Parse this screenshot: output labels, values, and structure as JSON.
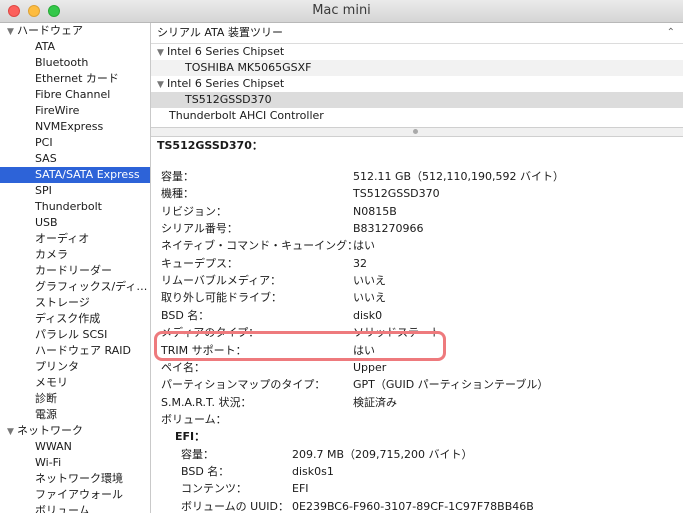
{
  "window": {
    "title": "Mac mini"
  },
  "sidebar": {
    "hardware_label": "ハードウェア",
    "hardware_items": [
      "ATA",
      "Bluetooth",
      "Ethernet カード",
      "Fibre Channel",
      "FireWire",
      "NVMExpress",
      "PCI",
      "SAS",
      "SATA/SATA Express",
      "SPI",
      "Thunderbolt",
      "USB",
      "オーディオ",
      "カメラ",
      "カードリーダー",
      "グラフィックス/ディ…",
      "ストレージ",
      "ディスク作成",
      "パラレル SCSI",
      "ハードウェア RAID",
      "プリンタ",
      "メモリ",
      "診断",
      "電源"
    ],
    "selected_item": "SATA/SATA Express",
    "network_label": "ネットワーク",
    "network_items": [
      "WWAN",
      "Wi-Fi",
      "ネットワーク環境",
      "ファイアウォール",
      "ボリューム"
    ]
  },
  "tree": {
    "header": "シリアル ATA 装置ツリー",
    "rows": [
      {
        "text": "Intel 6 Series Chipset",
        "level": 0
      },
      {
        "text": "TOSHIBA MK5065GSXF",
        "level": 1
      },
      {
        "text": "Intel 6 Series Chipset",
        "level": 0
      },
      {
        "text": "TS512GSSD370",
        "level": 1,
        "selected": true
      },
      {
        "text": "Thunderbolt AHCI Controller",
        "level": 0
      }
    ]
  },
  "detail": {
    "title": "TS512GSSD370：",
    "rows": [
      {
        "k": "容量：",
        "v": "512.11 GB（512,110,190,592 バイト）"
      },
      {
        "k": "機種：",
        "v": "TS512GSSD370"
      },
      {
        "k": "リビジョン：",
        "v": "N0815B"
      },
      {
        "k": "シリアル番号：",
        "v": "B831270966"
      },
      {
        "k": "ネイティブ・コマンド・キューイング：",
        "v": "はい"
      },
      {
        "k": "キューデプス：",
        "v": "32"
      },
      {
        "k": "リムーバブルメディア：",
        "v": "いいえ"
      },
      {
        "k": "取り外し可能ドライブ：",
        "v": "いいえ"
      },
      {
        "k": "BSD 名：",
        "v": "disk0"
      },
      {
        "k": "メディアのタイプ：",
        "v": "ソリッドステート"
      },
      {
        "k": "TRIM サポート：",
        "v": "はい"
      },
      {
        "k": "ペイ名：",
        "v": "Upper"
      },
      {
        "k": "パーティションマップのタイプ：",
        "v": "GPT（GUID パーティションテーブル）"
      },
      {
        "k": "S.M.A.R.T. 状況：",
        "v": "検証済み"
      },
      {
        "k": "ボリューム：",
        "v": ""
      }
    ],
    "volume_name": "EFI：",
    "volume_rows": [
      {
        "k": "容量：",
        "v": "209.7 MB（209,715,200 バイト）"
      },
      {
        "k": "BSD 名：",
        "v": "disk0s1"
      },
      {
        "k": "コンテンツ：",
        "v": "EFI"
      },
      {
        "k": "ボリュームの UUID：",
        "v": "0E239BC6-F960-3107-89CF-1C97F78BB46B"
      }
    ]
  },
  "colors": {
    "selection": "#2d63d8",
    "highlight_ring": "#ee7a7d"
  }
}
